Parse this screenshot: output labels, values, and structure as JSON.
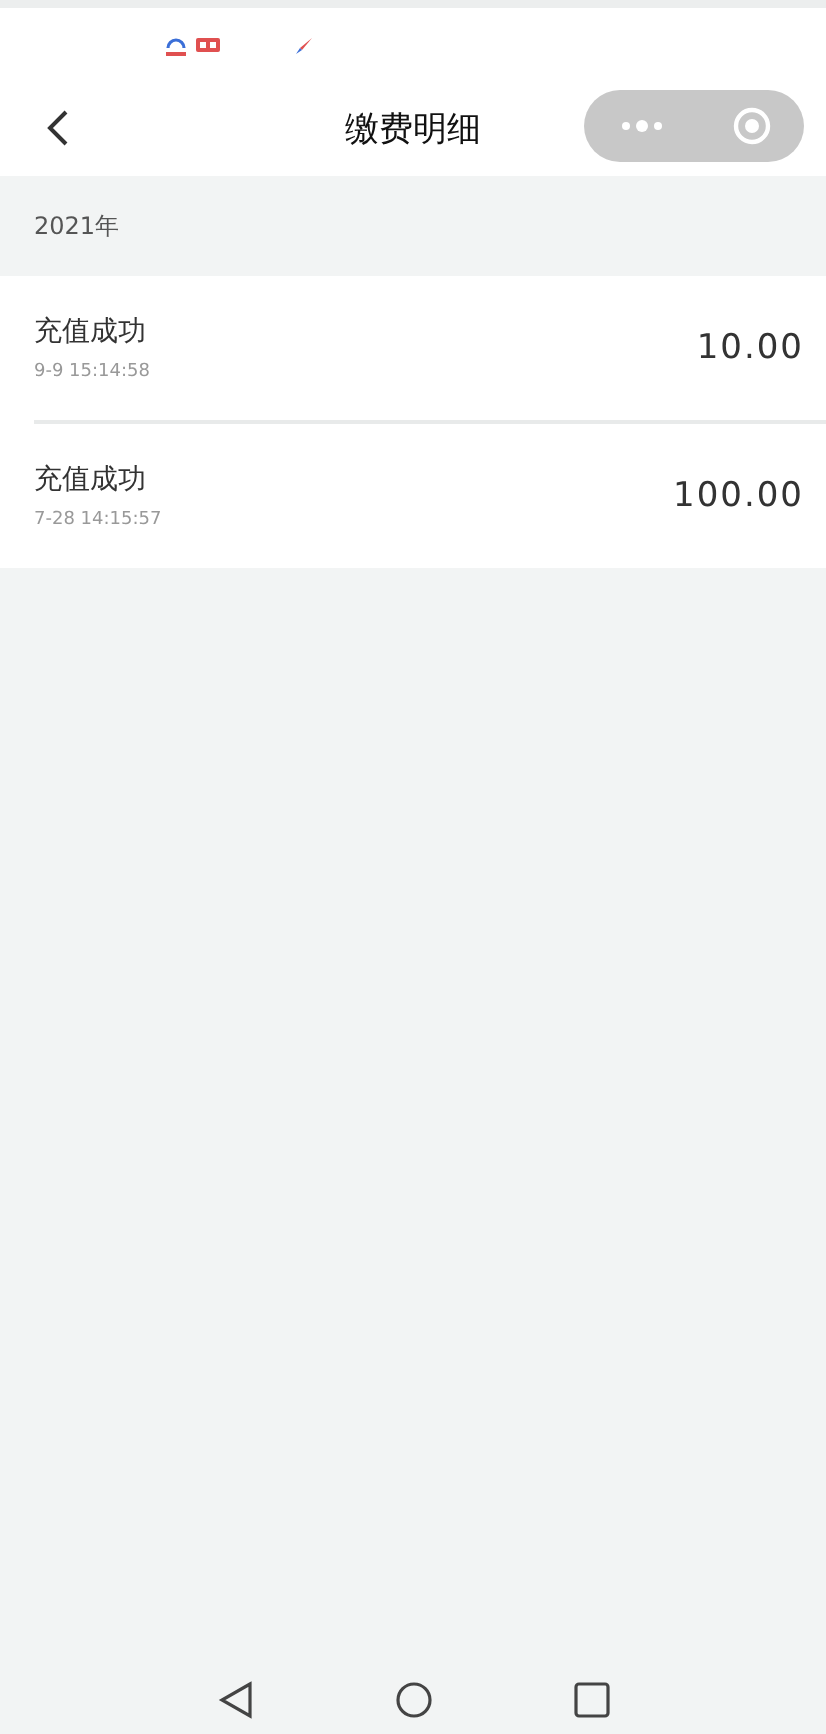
{
  "nav": {
    "title": "缴费明细"
  },
  "group": {
    "year": "2021年"
  },
  "records": [
    {
      "title": "充值成功",
      "time": "9-9 15:14:58",
      "amount": "10.00"
    },
    {
      "title": "充值成功",
      "time": "7-28 14:15:57",
      "amount": "100.00"
    }
  ]
}
